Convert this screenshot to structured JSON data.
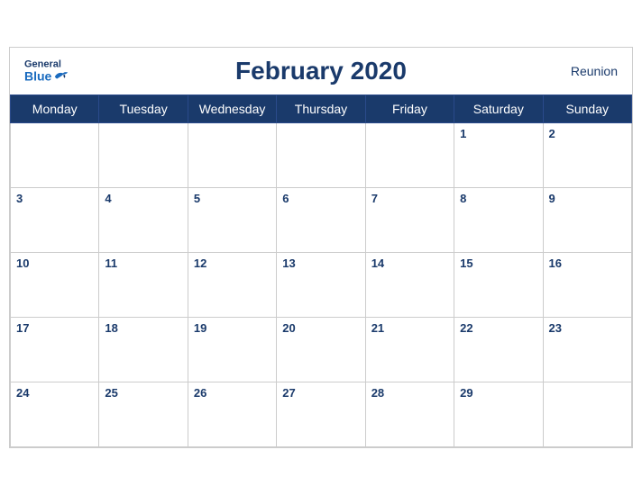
{
  "header": {
    "title": "February 2020",
    "logo_general": "General",
    "logo_blue": "Blue",
    "region": "Reunion"
  },
  "days_of_week": [
    "Monday",
    "Tuesday",
    "Wednesday",
    "Thursday",
    "Friday",
    "Saturday",
    "Sunday"
  ],
  "weeks": [
    [
      "",
      "",
      "",
      "",
      "",
      "1",
      "2"
    ],
    [
      "3",
      "4",
      "5",
      "6",
      "7",
      "8",
      "9"
    ],
    [
      "10",
      "11",
      "12",
      "13",
      "14",
      "15",
      "16"
    ],
    [
      "17",
      "18",
      "19",
      "20",
      "21",
      "22",
      "23"
    ],
    [
      "24",
      "25",
      "26",
      "27",
      "28",
      "29",
      ""
    ]
  ]
}
